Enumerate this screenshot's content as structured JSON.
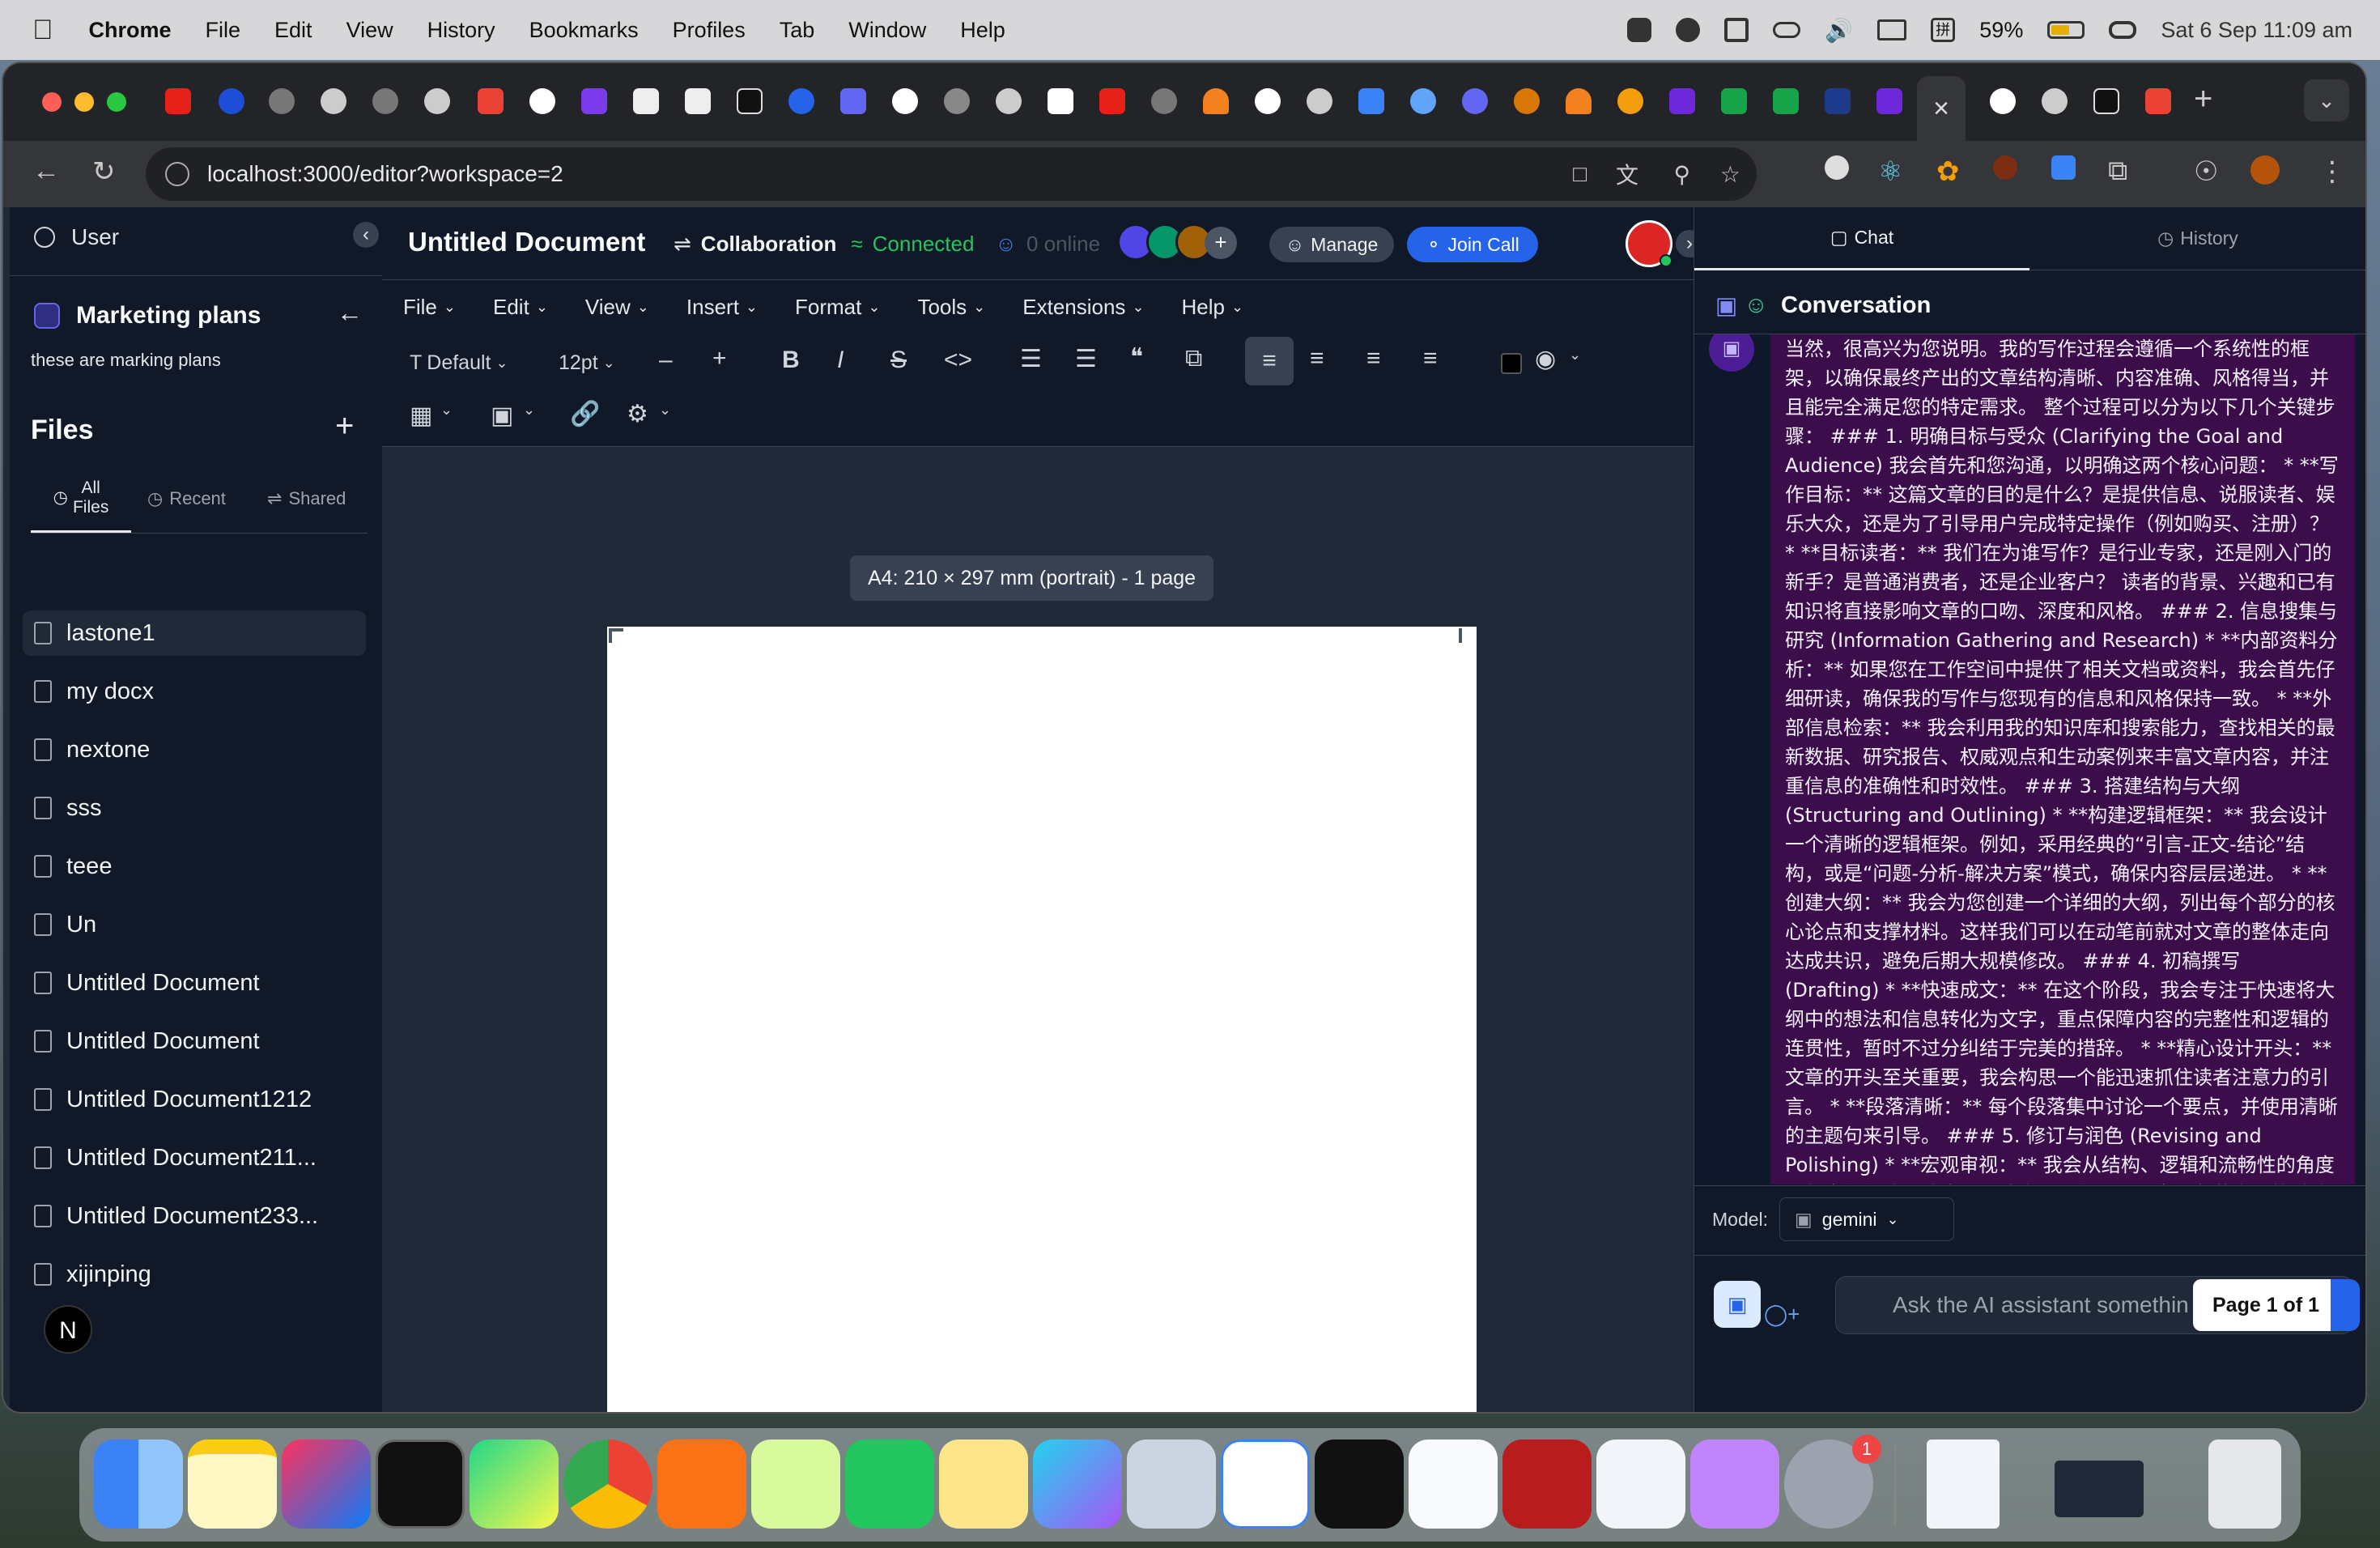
{
  "menubar": {
    "app": "Chrome",
    "items": [
      "File",
      "Edit",
      "View",
      "History",
      "Bookmarks",
      "Profiles",
      "Tab",
      "Window",
      "Help"
    ],
    "battery": "59%",
    "datetime": "Sat 6 Sep  11:09 am"
  },
  "browser": {
    "url": "localhost:3000/editor?workspace=2"
  },
  "sidebar": {
    "user_label": "User",
    "workspace_title": "Marketing plans",
    "workspace_desc": "these are marking plans",
    "files_heading": "Files",
    "tabs": [
      {
        "label": "All\nFiles"
      },
      {
        "label": "Recent"
      },
      {
        "label": "Shared"
      }
    ],
    "files": [
      "lastone1",
      "my docx",
      "nextone",
      "sss",
      "teee",
      "Un",
      "Untitled Document",
      "Untitled Document",
      "Untitled Document1212",
      "Untitled Document211...",
      "Untitled Document233...",
      "xijinping"
    ],
    "avatar_letter": "N"
  },
  "editor": {
    "title": "Untitled Document",
    "collab_label": "Collaboration",
    "status": "Connected",
    "online": "0 online",
    "manage": "Manage",
    "join_call": "Join Call",
    "menus": [
      "File",
      "Edit",
      "View",
      "Insert",
      "Format",
      "Tools",
      "Extensions",
      "Help"
    ],
    "font": "Default",
    "size": "12pt",
    "page_info": "A4: 210 × 297 mm (portrait) - 1 page"
  },
  "right": {
    "tab_chat": "Chat",
    "tab_history": "History",
    "conversation_title": "Conversation",
    "message": "当然，很高兴为您说明。我的写作过程会遵循一个系统性的框架，以确保最终产出的文章结构清晰、内容准确、风格得当，并且能完全满足您的特定需求。 整个过程可以分为以下几个关键步骤： ### 1. 明确目标与受众 (Clarifying the Goal and Audience) 我会首先和您沟通，以明确这两个核心问题： * **写作目标：** 这篇文章的目的是什么？是提供信息、说服读者、娱乐大众，还是为了引导用户完成特定操作（例如购买、注册）？ * **目标读者：** 我们在为谁写作？是行业专家，还是刚入门的新手？是普通消费者，还是企业客户？ 读者的背景、兴趣和已有知识将直接影响文章的口吻、深度和风格。 ### 2. 信息搜集与研究 (Information Gathering and Research) * **内部资料分析：** 如果您在工作空间中提供了相关文档或资料，我会首先仔细研读，确保我的写作与您现有的信息和风格保持一致。 * **外部信息检索：** 我会利用我的知识库和搜索能力，查找相关的最新数据、研究报告、权威观点和生动案例来丰富文章内容，并注重信息的准确性和时效性。 ### 3. 搭建结构与大纲 (Structuring and Outlining) * **构建逻辑框架：** 我会设计一个清晰的逻辑框架。例如，采用经典的“引言-正文-结论”结构，或是“问题-分析-解决方案”模式，确保内容层层递进。 * **创建大纲：** 我会为您创建一个详细的大纲，列出每个部分的核心论点和支撑材料。这样我们可以在动笔前就对文章的整体走向达成共识，避免后期大规模修改。 ### 4. 初稿撰写 (Drafting) * **快速成文：** 在这个阶段，我会专注于快速将大纲中的想法和信息转化为文字，重点保障内容的完整性和逻辑的连贯性，暂时不过分纠结于完美的措辞。 * **精心设计开头：** 文章的开头至关重要，我会构思一个能迅速抓住读者注意力的引言。 * **段落清晰：** 每个段落集中讨论一个要点，并使用清晰的主题句来引导。 ### 5. 修订与润色 (Revising and Polishing) * **宏观审视：** 我会从结构、逻辑和流畅性的角度重新审视初稿。论点是否清晰？逻辑是否严密？段落之间的过渡是否自然？",
    "model_label": "Model:",
    "model_value": "gemini",
    "input_placeholder": "Ask the AI assistant somethin",
    "page_badge": "Page 1 of 1"
  },
  "dock_notification": "1",
  "colors": {
    "accent_blue": "#2563eb",
    "connected_green": "#22c55e",
    "chat_bubble": "#3b0d4a"
  }
}
